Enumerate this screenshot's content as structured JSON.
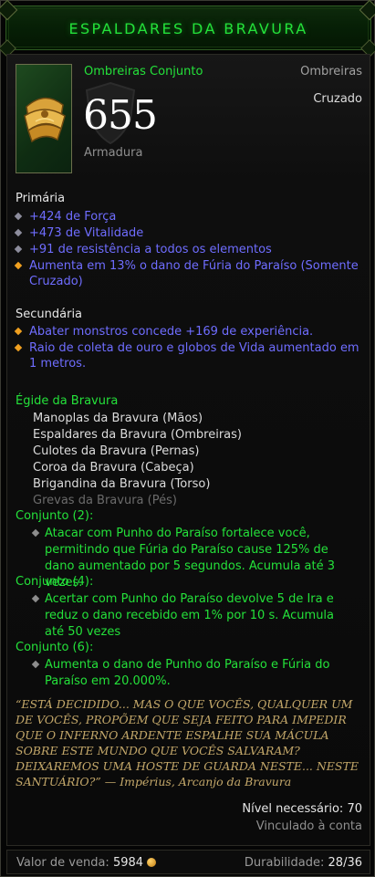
{
  "header": {
    "title": "ESPALDARES DA BRAVURA"
  },
  "item": {
    "type_name": "Ombreiras Conjunto",
    "slot": "Ombreiras",
    "class": "Cruzado",
    "armor_value": "655",
    "armor_label": "Armadura",
    "icon": "gold-shoulder-armor-icon"
  },
  "primary": {
    "heading": "Primária",
    "affixes": [
      {
        "text": "+424 de Força",
        "bullet": "grey"
      },
      {
        "text": "+473 de Vitalidade",
        "bullet": "grey"
      },
      {
        "text": "+91 de resistência a todos os elementos",
        "bullet": "grey"
      },
      {
        "text": "Aumenta em 13% o dano de Fúria do Paraíso (Somente Cruzado)",
        "bullet": "gold"
      }
    ]
  },
  "secondary": {
    "heading": "Secundária",
    "affixes": [
      {
        "text": "Abater monstros concede +169 de experiência.",
        "bullet": "gold"
      },
      {
        "text": "Raio de coleta de ouro e globos de Vida aumentado em 1 metros.",
        "bullet": "gold"
      }
    ]
  },
  "set": {
    "name": "Égide da Bravura",
    "items": [
      {
        "text": "Manoplas da Bravura (Mãos)",
        "owned": true
      },
      {
        "text": "Espaldares da Bravura (Ombreiras)",
        "owned": true
      },
      {
        "text": "Culotes da Bravura (Pernas)",
        "owned": true
      },
      {
        "text": "Coroa da Bravura (Cabeça)",
        "owned": true
      },
      {
        "text": "Brigandina da Bravura (Torso)",
        "owned": true
      },
      {
        "text": "Grevas da Bravura (Pés)",
        "owned": false
      }
    ],
    "bonuses": [
      {
        "label": "Conjunto (2):",
        "text": "Atacar com Punho do Paraíso fortalece você, permitindo que Fúria do Paraíso cause 125% de dano aumentado por 5 segundos. Acumula até 3 vezes."
      },
      {
        "label": "Conjunto (4):",
        "text": "Acertar com Punho do Paraíso devolve 5 de Ira e reduz o dano recebido em 1% por 10 s. Acumula até 50 vezes"
      },
      {
        "label": "Conjunto (6):",
        "text": "Aumenta o dano de Punho do Paraíso e Fúria do Paraíso em 20.000%."
      }
    ]
  },
  "flavor": {
    "quote": "“ESTÁ DECIDIDO... MAS O QUE VOCÊS, QUALQUER UM DE VOCÊS, PROPÕEM QUE SEJA FEITO PARA IMPEDIR QUE O INFERNO ARDENTE ESPALHE SUA MÁCULA SOBRE ESTE MUNDO QUE VOCÊS SALVARAM? DEIXAREMOS UMA HOSTE DE GUARDA NESTE... NESTE SANTUÁRIO?” —",
    "attribution": "Impérius, Arcanjo da Bravura"
  },
  "requirements": {
    "level": "Nível necessário: 70",
    "bound": "Vinculado à conta"
  },
  "footer": {
    "sell_label": "Valor de venda:",
    "sell_value": "5984",
    "durability_label": "Durabilidade:",
    "durability_value": "28/36"
  },
  "colors": {
    "set_green": "#24e13a",
    "magic_blue": "#6f6dff",
    "flavor_gold": "#c4a86a"
  }
}
